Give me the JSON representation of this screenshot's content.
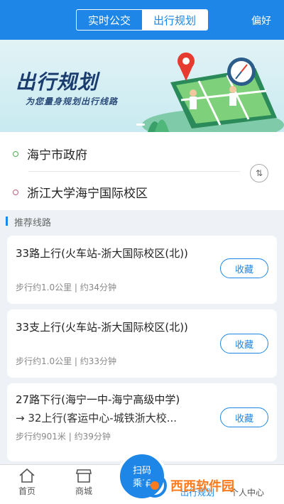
{
  "header": {
    "tabs": [
      "实时公交",
      "出行规划"
    ],
    "active_tab": 1,
    "preference": "偏好"
  },
  "banner": {
    "title": "出行规划",
    "subtitle": "为您量身规划出行线路"
  },
  "places": {
    "origin": "海宁市政府",
    "destination": "浙江大学海宁国际校区",
    "swap_glyph": "⇅"
  },
  "section_title": "推荐线路",
  "routes": [
    {
      "name": "33路上行(火车站-浙大国际校区(北))",
      "info": "步行约1.0公里 | 约34分钟",
      "fav": "收藏"
    },
    {
      "name": "33支上行(火车站-浙大国际校区(北))",
      "info": "步行约1.0公里 | 约33分钟",
      "fav": "收藏"
    },
    {
      "name": "27路下行(海宁一中-海宁高级中学)",
      "name2": "→ 32上行(客运中心-城铁浙大校...",
      "info": "步行约901米 | 约39分钟",
      "fav": "收藏"
    }
  ],
  "tabbar": {
    "items": [
      "首页",
      "商城",
      "出行规划",
      "个人中心"
    ],
    "scan": [
      "扫码",
      "乘车"
    ]
  },
  "watermark": "西西软件园",
  "colors": {
    "brand": "#1e86e6"
  }
}
